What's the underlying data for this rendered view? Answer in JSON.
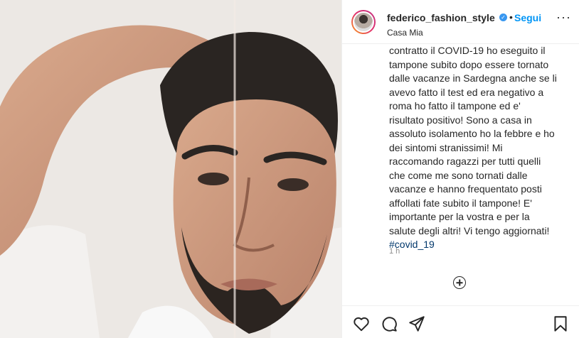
{
  "post": {
    "username": "federico_fashion_style",
    "verified_glyph": "✓",
    "separator": "•",
    "follow_label": "Segui",
    "more_label": "···",
    "location": "Casa Mia",
    "caption_lines": [
      "contratto il COVID-19 ho eseguito il",
      "tampone subito dopo essere tornato",
      "dalle vacanze in Sardegna anche se li",
      "avevo fatto il test ed era negativo a",
      "roma ho fatto il tampone ed e'",
      "risultato positivo! Sono a casa in",
      "assoluto isolamento ho la febbre e ho",
      "dei sintomi stranissimi! Mi",
      "raccomando ragazzi per tutti quelli",
      "che come me sono tornati dalle",
      "vacanze e hanno frequentato posti",
      "affollati fate subito il tampone! E'",
      "importante per la vostra e per la",
      "salute degli altri! Vi tengo aggiornati!"
    ],
    "hashtag": "#covid_19",
    "time_ago": "1 h"
  },
  "icons": {
    "like": "heart-icon",
    "comment": "comment-icon",
    "share": "share-icon",
    "save": "bookmark-icon",
    "add_comment": "plus-circle-icon"
  },
  "colors": {
    "link_blue": "#0095f6",
    "hashtag": "#00376b",
    "muted": "#8e8e8e"
  }
}
